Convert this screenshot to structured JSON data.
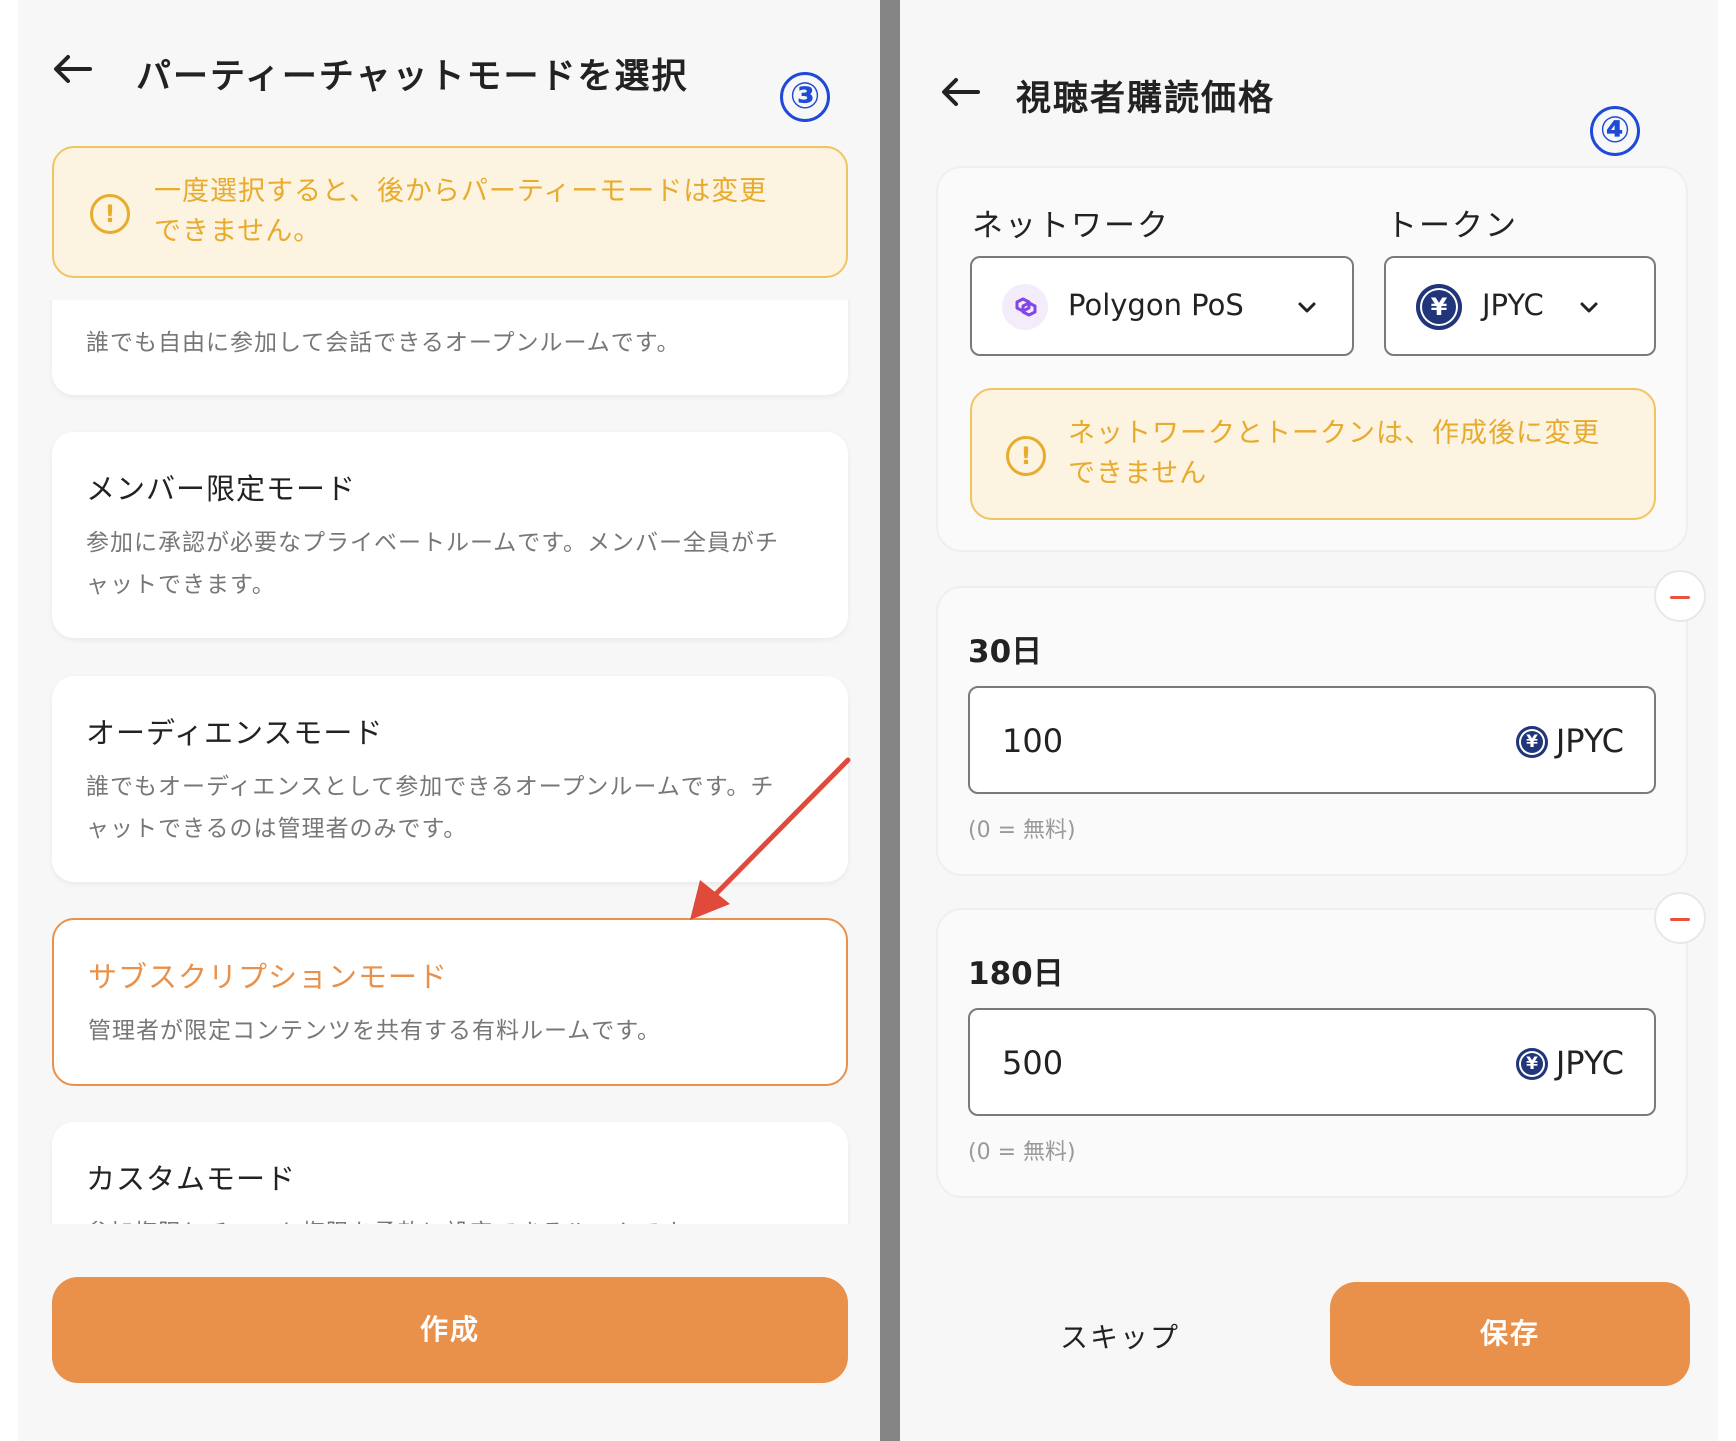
{
  "left": {
    "header": {
      "title": "パーティーチャットモードを選択",
      "step": "③"
    },
    "warning": {
      "line1": "一度選択すると、後からパーティーモードは変更",
      "line2": "できません。"
    },
    "modes": [
      {
        "title": "",
        "desc1": "誰でも自由に参加して会話できるオープンルームです。",
        "desc2": ""
      },
      {
        "title": "メンバー限定モード",
        "desc1": "参加に承認が必要なプライベートルームです。メンバー全員がチ",
        "desc2": "ャットできます。"
      },
      {
        "title": "オーディエンスモード",
        "desc1": "誰でもオーディエンスとして参加できるオープンルームです。チ",
        "desc2": "ャットできるのは管理者のみです。"
      },
      {
        "title": "サブスクリプションモード",
        "desc1": "管理者が限定コンテンツを共有する有料ルームです。",
        "desc2": ""
      },
      {
        "title": "カスタムモード",
        "desc1": "参加権限とチャット権限を柔軟に設定できるルームです。",
        "desc2": ""
      }
    ],
    "create_label": "作成"
  },
  "right": {
    "header": {
      "title": "視聴者購読価格",
      "step": "④"
    },
    "network": {
      "label": "ネットワーク",
      "value": "Polygon PoS"
    },
    "token": {
      "label": "トークン",
      "value": "JPYC"
    },
    "warning": {
      "line1": "ネットワークとトークンは、作成後に変更",
      "line2": "できません"
    },
    "plans": [
      {
        "title": "30日",
        "price": "100",
        "unit": "JPYC",
        "hint": "(0 = 無料)"
      },
      {
        "title": "180日",
        "price": "500",
        "unit": "JPYC",
        "hint": "(0 = 無料)"
      }
    ],
    "skip_label": "スキップ",
    "save_label": "保存"
  },
  "colors": {
    "accent": "#e9914a",
    "warning_text": "#e7ab2d",
    "warning_bg": "#fdf3e1",
    "step_mark": "#1f49d8",
    "token_icon": "#21357a",
    "remove": "#e7533e",
    "arrow": "#e04a3a"
  },
  "icons": {
    "back": "arrow-left-icon",
    "warning": "exclamation-circle-icon",
    "network": "polygon-icon",
    "token": "yen-coin-icon",
    "dropdown": "chevron-down-icon",
    "remove": "minus-circle-icon"
  }
}
